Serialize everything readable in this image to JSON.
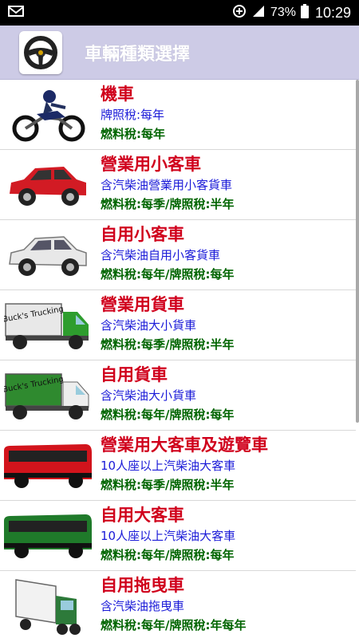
{
  "status_bar": {
    "notification_icon": "gmail-icon",
    "battery_percent": "73%",
    "time": "10:29"
  },
  "app_bar": {
    "icon": "steering-wheel-icon",
    "title": "車輛種類選擇"
  },
  "vehicles": [
    {
      "title": "機車",
      "desc": "牌照稅:每年",
      "tax": "燃料稅:每年",
      "icon": "motorcycle-icon",
      "color": "#1c2a66"
    },
    {
      "title": "營業用小客車",
      "desc": "含汽柴油營業用小客貨車",
      "tax": "燃料稅:每季/牌照稅:半年",
      "icon": "red-suv-icon",
      "color": "#d21b24"
    },
    {
      "title": "自用小客車",
      "desc": "含汽柴油自用小客貨車",
      "tax": "燃料稅:每年/牌照稅:每年",
      "icon": "white-suv-icon",
      "color": "#e8e8e8"
    },
    {
      "title": "營業用貨車",
      "desc": "含汽柴油大小貨車",
      "tax": "燃料稅:每季/牌照稅:半年",
      "icon": "truck-icon",
      "cargo_text": "Buck's Trucking",
      "cargo": "#e8e8e8",
      "cab": "#2e9d2e"
    },
    {
      "title": "自用貨車",
      "desc": "含汽柴油大小貨車",
      "tax": "燃料稅:每年/牌照稅:每年",
      "icon": "truck-icon",
      "cargo_text": "Buck's Trucking",
      "cargo": "#2f8a2f",
      "cab": "#eeeeee"
    },
    {
      "title": "營業用大客車及遊覽車",
      "desc": "10人座以上汽柴油大客車",
      "tax": "燃料稅:每季/牌照稅:半年",
      "icon": "red-bus-icon",
      "color": "#d2141c"
    },
    {
      "title": "自用大客車",
      "desc": "10人座以上汽柴油大客車",
      "tax": "燃料稅:每年/牌照稅:每年",
      "icon": "green-bus-icon",
      "color": "#1f7a2a"
    },
    {
      "title": "自用拖曳車",
      "desc": "含汽柴油拖曳車",
      "tax": "燃料稅:每年/牌照稅:年每年",
      "icon": "semi-truck-icon",
      "color": "#2d7a3a"
    }
  ]
}
